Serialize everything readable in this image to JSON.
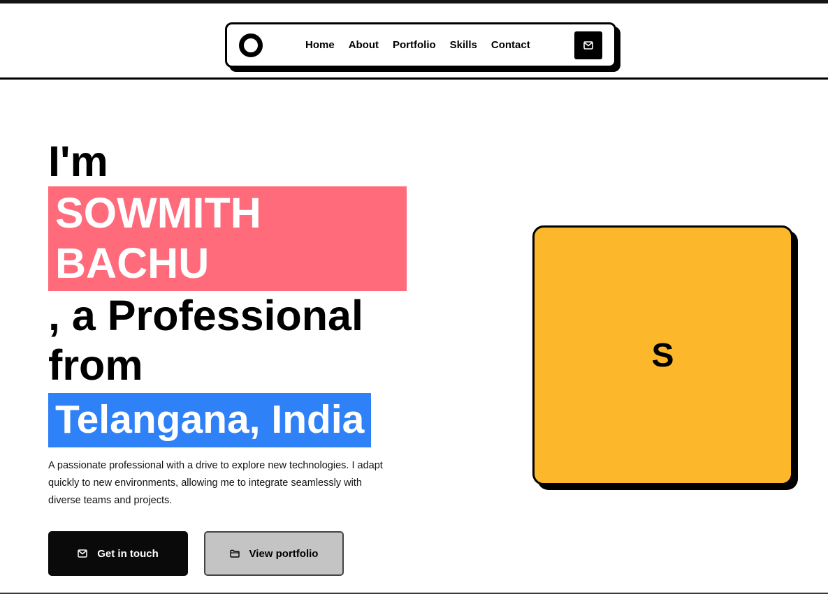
{
  "nav": {
    "links": [
      {
        "label": "Home"
      },
      {
        "label": "About"
      },
      {
        "label": "Portfolio"
      },
      {
        "label": "Skills"
      },
      {
        "label": "Contact"
      }
    ],
    "mail_icon": "mail-icon"
  },
  "hero": {
    "intro": "I'm",
    "name_line1": "SOWMITH",
    "name_line2": "BACHU",
    "role_line1": ", a Professional",
    "role_line2": "from",
    "location": "Telangana, India",
    "description": "A passionate professional with a drive to explore new technologies. I adapt quickly to new environments, allowing me to integrate seamlessly with diverse teams and projects."
  },
  "buttons": {
    "primary": {
      "label": "Get in touch",
      "icon": "mail-icon"
    },
    "secondary": {
      "label": "View portfolio",
      "icon": "folder-icon"
    }
  },
  "card": {
    "letter": "S"
  },
  "colors": {
    "name_highlight": "#ff6b7a",
    "location_highlight": "#2f81f7",
    "card_background": "#fdb72a",
    "primary_button": "#0a0a0a",
    "secondary_button": "#c4c4c4"
  }
}
